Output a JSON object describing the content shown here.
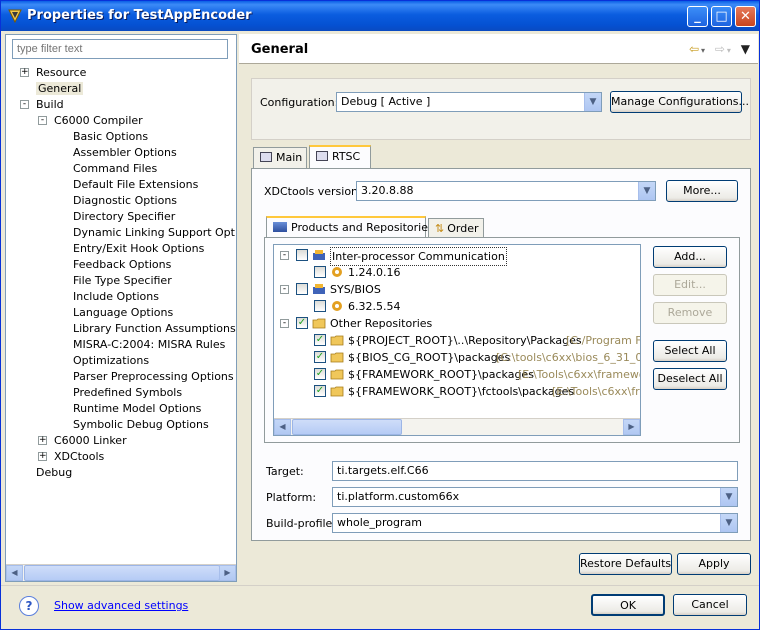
{
  "window": {
    "title": "Properties for TestAppEncoder",
    "controls": [
      "minimize-icon",
      "maximize-icon",
      "close-icon"
    ]
  },
  "left": {
    "filter_placeholder": "type filter text",
    "tree": [
      {
        "label": "Resource",
        "expander": "+"
      },
      {
        "label": "General",
        "selected": true
      },
      {
        "label": "Build",
        "expander": "-"
      },
      {
        "label": "C6000 Compiler",
        "expander": "-"
      },
      {
        "label": "Basic Options"
      },
      {
        "label": "Assembler Options"
      },
      {
        "label": "Command Files"
      },
      {
        "label": "Default File Extensions"
      },
      {
        "label": "Diagnostic Options"
      },
      {
        "label": "Directory Specifier"
      },
      {
        "label": "Dynamic Linking Support Options"
      },
      {
        "label": "Entry/Exit Hook Options"
      },
      {
        "label": "Feedback Options"
      },
      {
        "label": "File Type Specifier"
      },
      {
        "label": "Include Options"
      },
      {
        "label": "Language Options"
      },
      {
        "label": "Library Function Assumptions"
      },
      {
        "label": "MISRA-C:2004: MISRA Rules"
      },
      {
        "label": "Optimizations"
      },
      {
        "label": "Parser Preprocessing Options"
      },
      {
        "label": "Predefined Symbols"
      },
      {
        "label": "Runtime Model Options"
      },
      {
        "label": "Symbolic Debug Options"
      },
      {
        "label": "C6000 Linker",
        "expander": "+"
      },
      {
        "label": "XDCtools",
        "expander": "+"
      },
      {
        "label": "Debug"
      }
    ]
  },
  "right": {
    "header": "General",
    "configuration_label": "Configuration:",
    "configuration_value": "Debug  [ Active ]",
    "manage_button": "Manage Configurations...",
    "tabs": [
      "Main",
      "RTSC"
    ],
    "xdc_label": "XDCtools version:",
    "xdc_value": "3.20.8.88",
    "more_button": "More...",
    "subtabs": [
      "Products and Repositories",
      "Order"
    ],
    "products": [
      {
        "label": "Inter-processor Communication",
        "checked": false,
        "expander": "-"
      },
      {
        "label": "1.24.0.16",
        "checked": false
      },
      {
        "label": "SYS/BIOS",
        "checked": false,
        "expander": "-"
      },
      {
        "label": "6.32.5.54",
        "checked": false
      },
      {
        "label": "Other Repositories",
        "checked": true,
        "expander": "-"
      },
      {
        "label": "${PROJECT_ROOT}\\..\\Repository\\Packages",
        "path": "[C:/Program Fil",
        "checked": true
      },
      {
        "label": "${BIOS_CG_ROOT}\\packages",
        "path": "[C:\\tools\\c6xx\\bios_6_31_00_",
        "checked": true
      },
      {
        "label": "${FRAMEWORK_ROOT}\\packages",
        "path": "[E:\\Tools\\c6xx\\framework",
        "checked": true
      },
      {
        "label": "${FRAMEWORK_ROOT}\\fctools\\packages",
        "path": "[E:\\Tools\\c6xx\\fra",
        "checked": true
      }
    ],
    "side_buttons": {
      "add": "Add...",
      "edit": "Edit...",
      "remove": "Remove",
      "select_all": "Select All",
      "deselect_all": "Deselect All"
    },
    "target_label": "Target:",
    "target_value": "ti.targets.elf.C66",
    "platform_label": "Platform:",
    "platform_value": "ti.platform.custom66x",
    "build_profile_label": "Build-profile:",
    "build_profile_value": "whole_program",
    "restore_button": "Restore Defaults",
    "apply_button": "Apply"
  },
  "footer": {
    "help_icon": "?",
    "advanced_link": "Show advanced settings",
    "ok_button": "OK",
    "cancel_button": "Cancel"
  }
}
